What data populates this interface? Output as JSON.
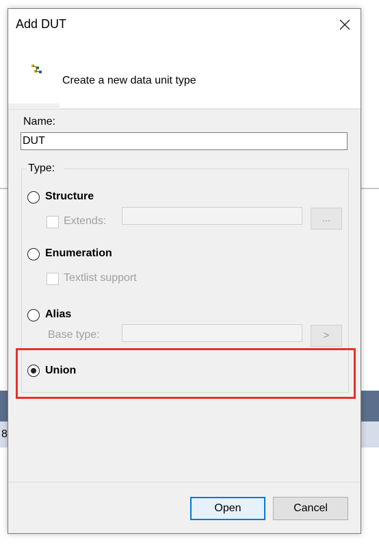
{
  "dialog": {
    "title": "Add DUT",
    "subtitle": "Create a new data unit type",
    "close_icon": "close-icon",
    "header_icon": "dut-wizard-icon"
  },
  "name": {
    "label": "Name:",
    "value": "DUT"
  },
  "type_group": {
    "label": "Type:",
    "options": {
      "structure": {
        "label": "Structure",
        "selected": false
      },
      "enumeration": {
        "label": "Enumeration",
        "selected": false
      },
      "alias": {
        "label": "Alias",
        "selected": false
      },
      "union": {
        "label": "Union",
        "selected": true
      }
    },
    "extends_label": "Extends:",
    "extends_browse": "...",
    "textlist_label": "Textlist support",
    "base_type_label": "Base type:",
    "base_type_button": ">"
  },
  "buttons": {
    "open": "Open",
    "cancel": "Cancel"
  },
  "background": {
    "row_text": "8"
  },
  "colors": {
    "highlight": "#e8302a",
    "primary_border": "#0078d7"
  }
}
